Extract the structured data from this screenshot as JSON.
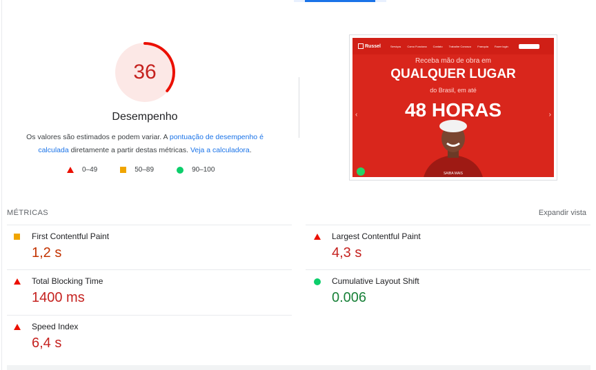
{
  "performance": {
    "score": "36",
    "label": "Desempenho",
    "description_prefix": "Os valores são estimados e podem variar. A ",
    "description_link1": "pontuação de desempenho é calculada",
    "description_middle": " diretamente a partir destas métricas. ",
    "description_link2": "Veja a calculadora",
    "description_suffix": ".",
    "score_fraction": 0.36,
    "colors": {
      "poor": "#c5221f",
      "poor_fill": "#fce8e6",
      "average": "#f0a500",
      "good": "#0cce6b"
    }
  },
  "legend": [
    {
      "icon": "triangle-icon",
      "range": "0–49"
    },
    {
      "icon": "square-icon",
      "range": "50–89"
    },
    {
      "icon": "circle-icon",
      "range": "90–100"
    }
  ],
  "screenshot": {
    "brand": "Russel",
    "brand_sub": "SERVIÇOS",
    "nav": [
      "Serviços",
      "Como Funciona",
      "Contato",
      "Trabalhe Conosco",
      "Franquia",
      "Fazer login"
    ],
    "line1": "Receba mão de obra em",
    "line2": "QUALQUER LUGAR",
    "line3": "do Brasil, em até",
    "line4": "48 HORAS",
    "cta": "SAIBA MAIS"
  },
  "metrics": {
    "title": "MÉTRICAS",
    "expand": "Expandir vista",
    "items": [
      {
        "name": "First Contentful Paint",
        "value": "1,2 s",
        "rating": "average"
      },
      {
        "name": "Largest Contentful Paint",
        "value": "4,3 s",
        "rating": "poor"
      },
      {
        "name": "Total Blocking Time",
        "value": "1400 ms",
        "rating": "poor"
      },
      {
        "name": "Cumulative Layout Shift",
        "value": "0.006",
        "rating": "good"
      },
      {
        "name": "Speed Index",
        "value": "6,4 s",
        "rating": "poor"
      }
    ]
  }
}
